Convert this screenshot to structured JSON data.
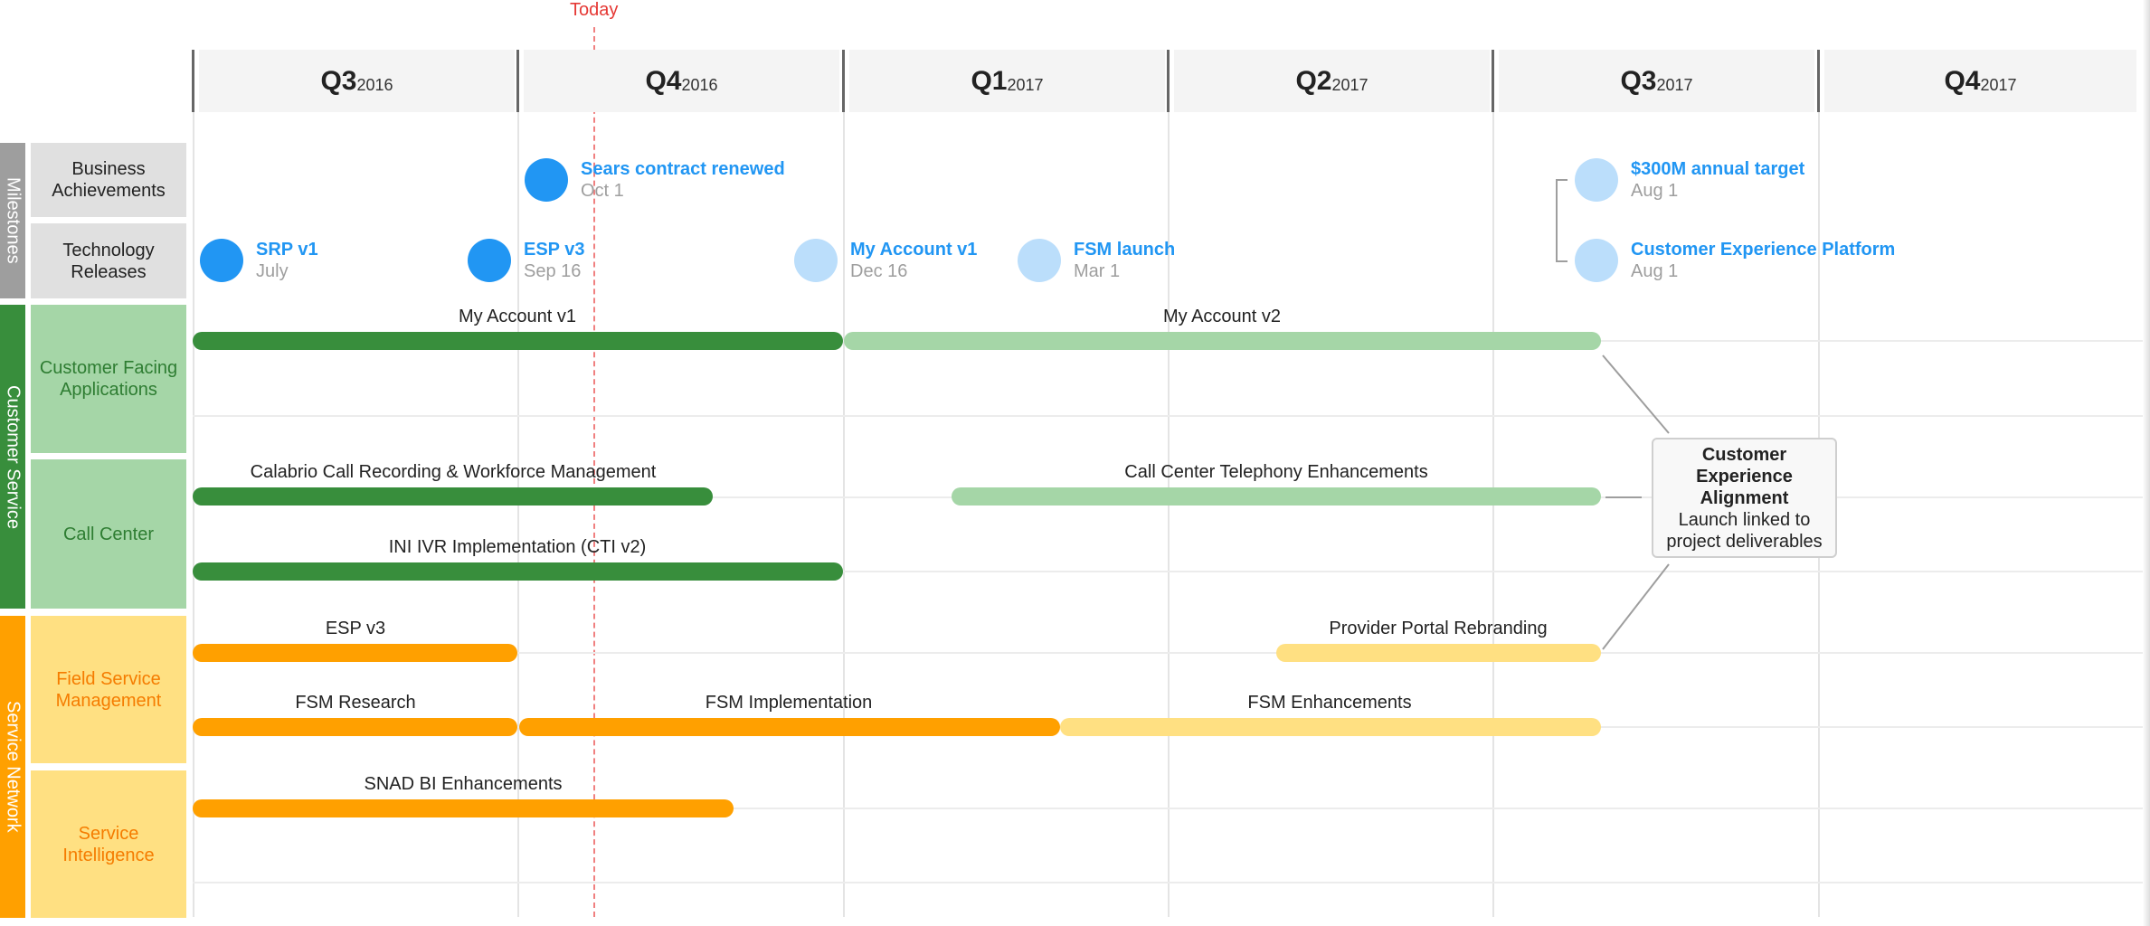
{
  "today_label": "Today",
  "quarters": [
    {
      "q": "Q3",
      "year": "2016"
    },
    {
      "q": "Q4",
      "year": "2016"
    },
    {
      "q": "Q1",
      "year": "2017"
    },
    {
      "q": "Q2",
      "year": "2017"
    },
    {
      "q": "Q3",
      "year": "2017"
    },
    {
      "q": "Q4",
      "year": "2017"
    }
  ],
  "groups": [
    {
      "label": "Milestones",
      "color": "#9e9e9e"
    },
    {
      "label": "Customer Service",
      "color": "#388e3c"
    },
    {
      "label": "Service Network",
      "color": "#ffa000"
    }
  ],
  "lanes": [
    {
      "label": "Business Achievements",
      "bg": "#e0e0e0",
      "fg": "#222222"
    },
    {
      "label": "Technology Releases",
      "bg": "#e0e0e0",
      "fg": "#222222"
    },
    {
      "label": "Customer Facing Applications",
      "bg": "#a5d6a7",
      "fg": "#2e7d32"
    },
    {
      "label": "Call Center",
      "bg": "#a5d6a7",
      "fg": "#2e7d32"
    },
    {
      "label": "Field Service Management",
      "bg": "#ffe082",
      "fg": "#f57c00"
    },
    {
      "label": "Service Intelligence",
      "bg": "#ffe082",
      "fg": "#f57c00"
    }
  ],
  "milestones": [
    {
      "title": "Sears contract renewed",
      "date": "Oct 1",
      "state": "done"
    },
    {
      "title": "$300M annual target",
      "date": "Aug 1",
      "state": "planned"
    },
    {
      "title": "SRP v1",
      "date": "July",
      "state": "done"
    },
    {
      "title": "ESP v3",
      "date": "Sep 16",
      "state": "done"
    },
    {
      "title": "My Account v1",
      "date": "Dec 16",
      "state": "planned"
    },
    {
      "title": "FSM launch",
      "date": "Mar 1",
      "state": "planned"
    },
    {
      "title": "Customer Experience Platform",
      "date": "Aug 1",
      "state": "planned"
    }
  ],
  "colors": {
    "milestone_done": "#2196f3",
    "milestone_planned": "#bbdefb",
    "green_done": "#388e3c",
    "green_planned": "#a5d6a7",
    "orange_done": "#ffa000",
    "orange_planned": "#ffe082"
  },
  "bars": [
    {
      "label": "My Account v1",
      "lane": "Customer Facing Applications",
      "state": "done"
    },
    {
      "label": "My Account v2",
      "lane": "Customer Facing Applications",
      "state": "planned"
    },
    {
      "label": "Calabrio Call Recording & Workforce Management",
      "lane": "Call Center",
      "state": "done"
    },
    {
      "label": "Call Center Telephony Enhancements",
      "lane": "Call Center",
      "state": "planned"
    },
    {
      "label": "INI IVR Implementation (CTI v2)",
      "lane": "Call Center",
      "state": "done"
    },
    {
      "label": "ESP v3",
      "lane": "Field Service Management",
      "state": "done"
    },
    {
      "label": "Provider Portal Rebranding",
      "lane": "Field Service Management",
      "state": "planned"
    },
    {
      "label": "FSM Research",
      "lane": "Field Service Management",
      "state": "done"
    },
    {
      "label": "FSM Implementation",
      "lane": "Field Service Management",
      "state": "done"
    },
    {
      "label": "FSM Enhancements",
      "lane": "Field Service Management",
      "state": "planned"
    },
    {
      "label": "SNAD BI Enhancements",
      "lane": "Service Intelligence",
      "state": "done"
    }
  ],
  "callout": {
    "title": "Customer Experience Alignment",
    "body": "Launch linked to project deliverables"
  }
}
